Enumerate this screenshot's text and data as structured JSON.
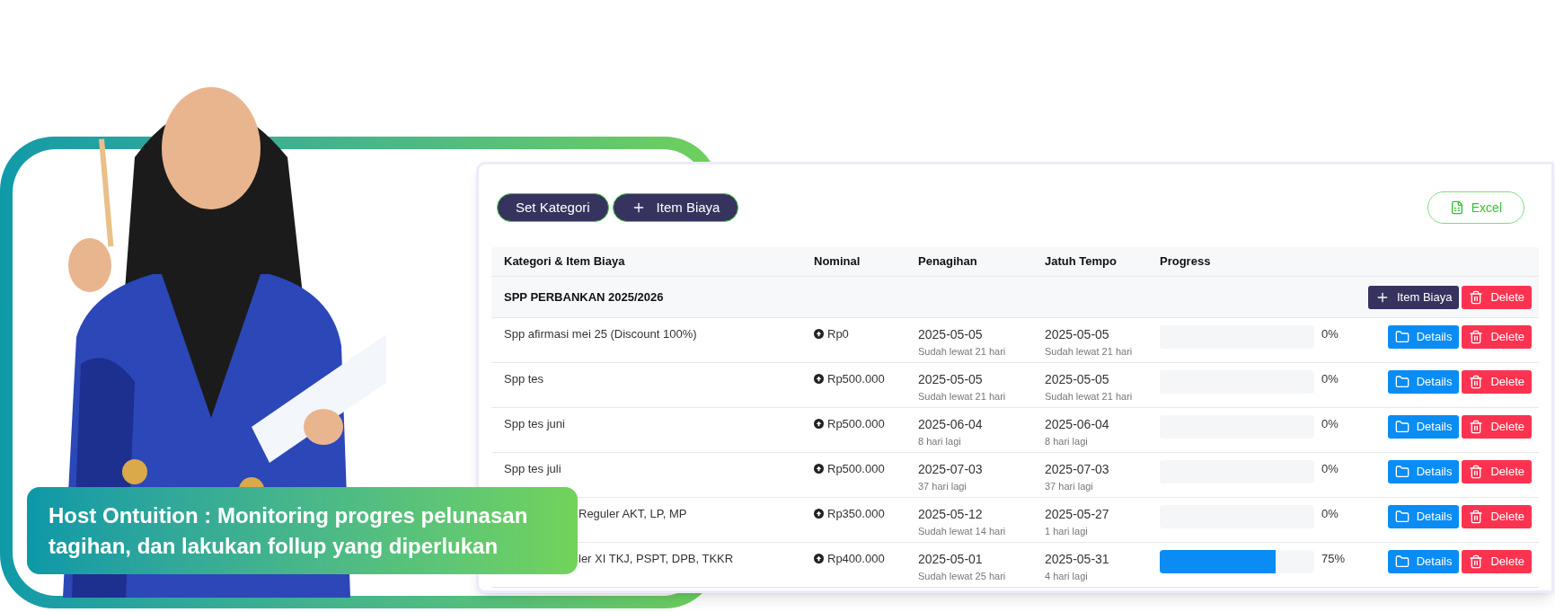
{
  "banner": {
    "text": "Host Ontuition : Monitoring progres pelunasan tagihan, dan lakukan follup yang diperlukan"
  },
  "toolbar": {
    "buttons": [
      {
        "label": "Set Kategori",
        "kind": "plain"
      },
      {
        "label": "Item Biaya",
        "kind": "add"
      }
    ],
    "export": {
      "label": "Excel"
    }
  },
  "table": {
    "columns": [
      "Kategori & Item Biaya",
      "Nominal",
      "Penagihan",
      "Jatuh Tempo",
      "Progress"
    ],
    "category": {
      "name": "SPP PERBANKAN 2025/2026",
      "actions": [
        {
          "label": "Item Biaya",
          "kind": "add"
        },
        {
          "label": "Delete",
          "kind": "delete"
        }
      ]
    },
    "rows": [
      {
        "name": "Spp afirmasi mei 25 (Discount 100%)",
        "partly_hidden": false,
        "nominal": "Rp0",
        "billing": "2025-05-05",
        "billing_note": "Sudah lewat 21 hari",
        "due": "2025-05-05",
        "due_note": "Sudah lewat 21 hari",
        "level": 0,
        "percent": "0%",
        "actions": [
          {
            "label": "Details",
            "kind": "details"
          },
          {
            "label": "Delete",
            "kind": "delete"
          }
        ]
      },
      {
        "name": "Spp tes",
        "partly_hidden": false,
        "nominal": "Rp500.000",
        "billing": "2025-05-05",
        "billing_note": "Sudah lewat 21 hari",
        "due": "2025-05-05",
        "due_note": "Sudah lewat 21 hari",
        "level": 0,
        "percent": "0%",
        "actions": [
          {
            "label": "Details",
            "kind": "details"
          },
          {
            "label": "Delete",
            "kind": "delete"
          }
        ]
      },
      {
        "name": "Spp tes juni",
        "partly_hidden": false,
        "nominal": "Rp500.000",
        "billing": "2025-06-04",
        "billing_note": "8 hari lagi",
        "due": "2025-06-04",
        "due_note": "8 hari lagi",
        "level": 0,
        "percent": "0%",
        "actions": [
          {
            "label": "Details",
            "kind": "details"
          },
          {
            "label": "Delete",
            "kind": "delete"
          }
        ]
      },
      {
        "name": "Spp tes juli",
        "partly_hidden": false,
        "nominal": "Rp500.000",
        "billing": "2025-07-03",
        "billing_note": "37 hari lagi",
        "due": "2025-07-03",
        "due_note": "37 hari lagi",
        "level": 0,
        "percent": "0%",
        "actions": [
          {
            "label": "Details",
            "kind": "details"
          },
          {
            "label": "Delete",
            "kind": "delete"
          }
        ]
      },
      {
        "name": "Reguler AKT, LP, MP",
        "partly_hidden": true,
        "nominal": "Rp350.000",
        "billing": "2025-05-12",
        "billing_note": "Sudah lewat 14 hari",
        "due": "2025-05-27",
        "due_note": "1 hari lagi",
        "level": 0,
        "percent": "0%",
        "actions": [
          {
            "label": "Details",
            "kind": "details"
          },
          {
            "label": "Delete",
            "kind": "delete"
          }
        ]
      },
      {
        "name": "ler XI TKJ, PSPT, DPB, TKKR",
        "partly_hidden": true,
        "nominal": "Rp400.000",
        "billing": "2025-05-01",
        "billing_note": "Sudah lewat 25 hari",
        "due": "2025-05-31",
        "due_note": "4 hari lagi",
        "level": 0.75,
        "percent": "75%",
        "actions": [
          {
            "label": "Details",
            "kind": "details"
          },
          {
            "label": "Delete",
            "kind": "delete"
          }
        ]
      }
    ]
  }
}
